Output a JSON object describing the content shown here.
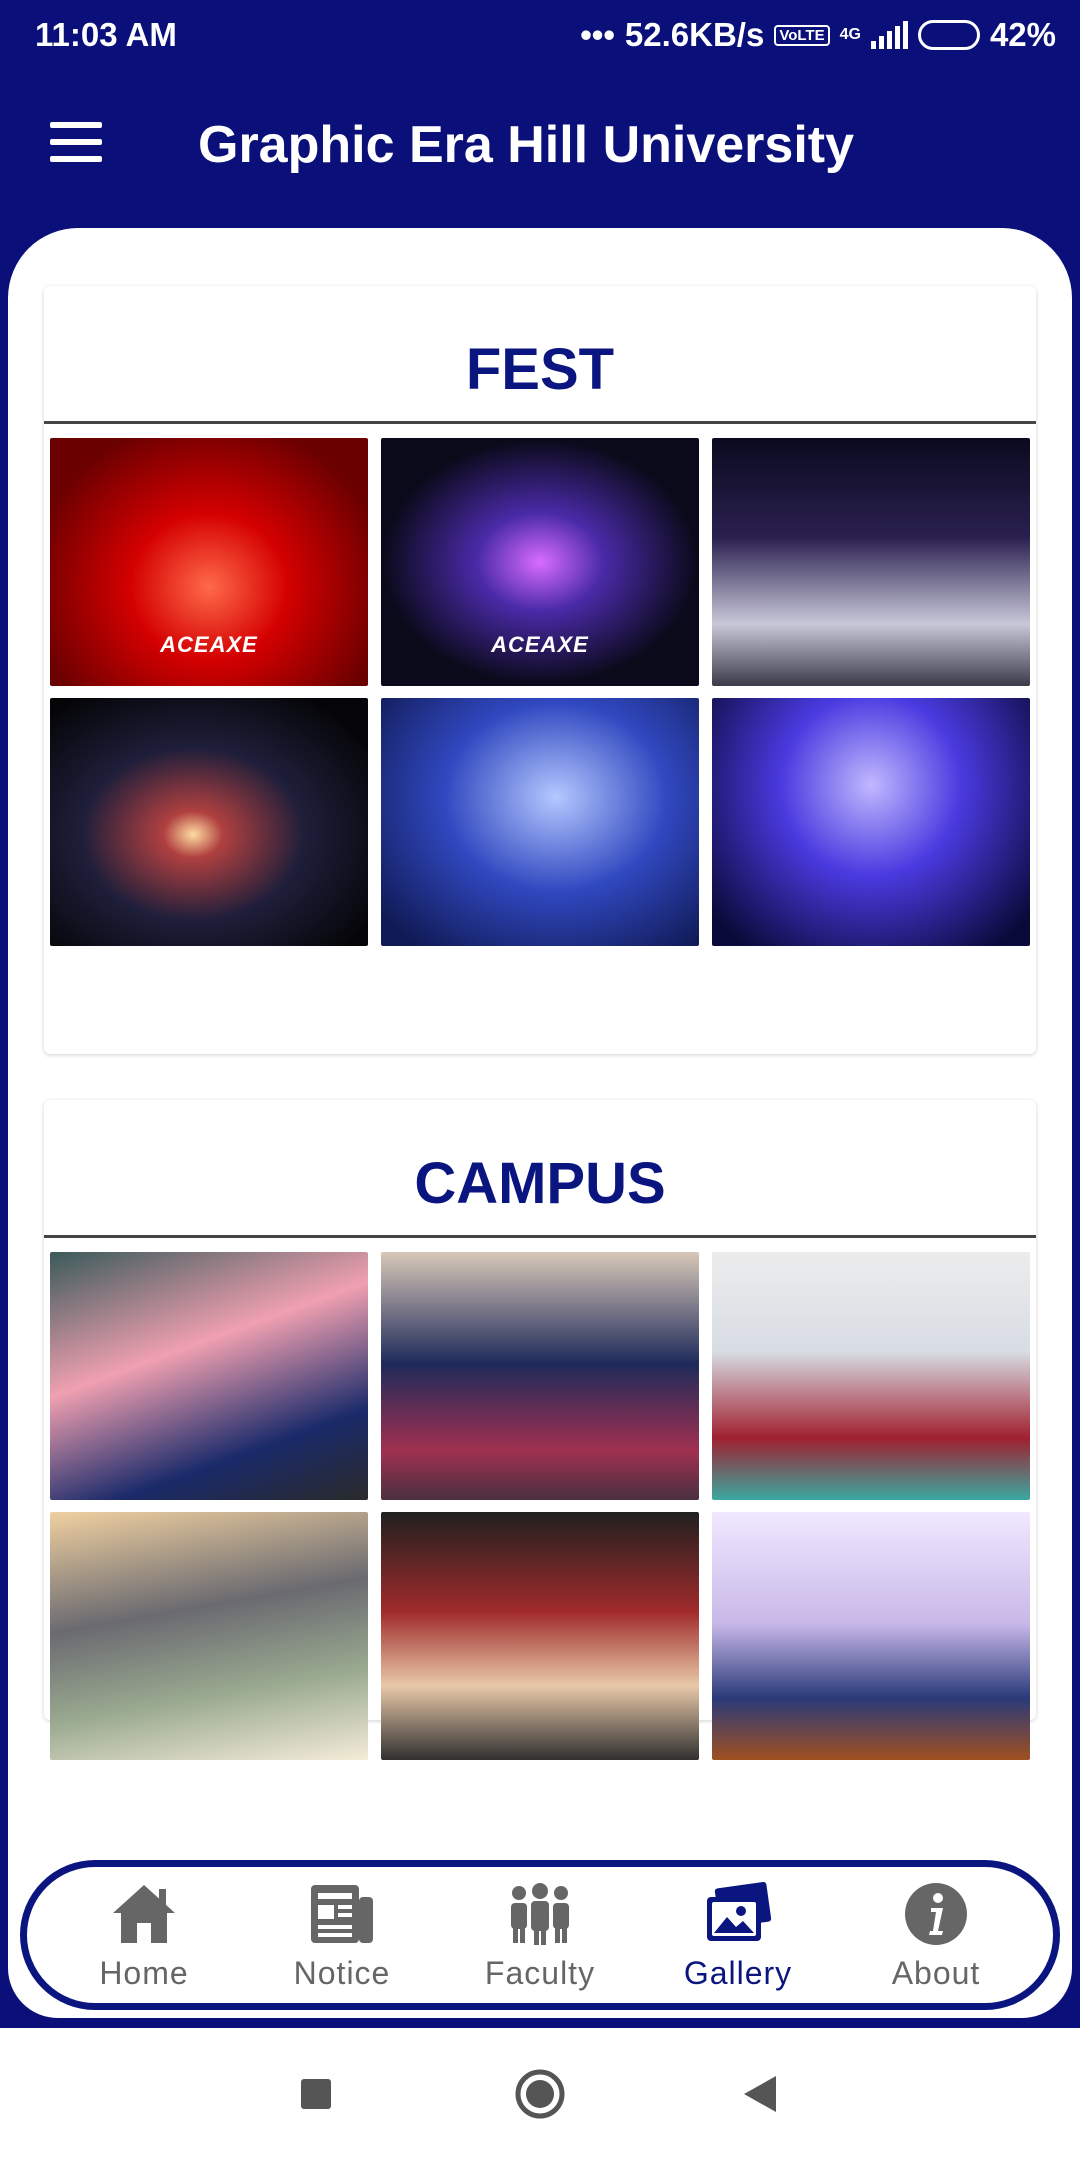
{
  "status_bar": {
    "time": "11:03 AM",
    "speed": "52.6KB/s",
    "volte": "VoLTE",
    "network": "4G",
    "battery": "42%",
    "battery_level": 0.42
  },
  "app_bar": {
    "menu_icon": "hamburger-menu-icon",
    "title": "Graphic Era Hill University"
  },
  "sections": [
    {
      "title": "FEST",
      "photos": [
        {
          "overlay_text": "ACEAXE"
        },
        {
          "overlay_text": "ACEAXE"
        },
        {
          "overlay_text": ""
        },
        {
          "overlay_text": ""
        },
        {
          "overlay_text": ""
        },
        {
          "overlay_text": ""
        }
      ]
    },
    {
      "title": "CAMPUS",
      "photos": [
        {
          "overlay_text": ""
        },
        {
          "overlay_text": ""
        },
        {
          "overlay_text": ""
        },
        {
          "overlay_text": ""
        },
        {
          "overlay_text": ""
        },
        {
          "overlay_text": ""
        }
      ]
    }
  ],
  "bottom_nav": {
    "items": [
      {
        "label": "Home",
        "icon": "home-icon"
      },
      {
        "label": "Notice",
        "icon": "newspaper-icon"
      },
      {
        "label": "Faculty",
        "icon": "people-icon"
      },
      {
        "label": "Gallery",
        "icon": "gallery-icon"
      },
      {
        "label": "About",
        "icon": "info-icon"
      }
    ],
    "active": "Gallery"
  },
  "colors": {
    "primary": "#0a0f7a",
    "title_text": "#0a1580",
    "inactive_nav": "#666666"
  }
}
